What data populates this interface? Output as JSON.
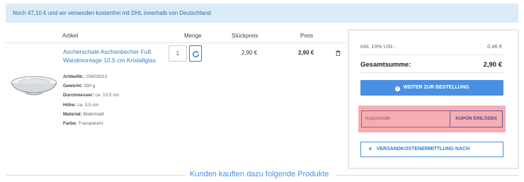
{
  "banner": {
    "text": "Noch 47,10 € und wir versenden kostenfrei mit DHL innerhalb von Deutschland"
  },
  "table": {
    "headers": {
      "article": "Artikel",
      "qty": "Menge",
      "unit_price": "Stückpreis",
      "price": "Preis"
    }
  },
  "item": {
    "title": "Ascherschale Aschenbecher Fuß Wandmontage 10,5 cm Kristallglas",
    "meta": [
      {
        "label": "ArtikelNr.:",
        "value": "GW03013"
      },
      {
        "label": "Gewicht:",
        "value": "330 g"
      },
      {
        "label": "Durchmesser:",
        "value": "ca. 10,5 cm"
      },
      {
        "label": "Höhe:",
        "value": "ca. 3,5 cm"
      },
      {
        "label": "Material:",
        "value": "Bleikristall"
      },
      {
        "label": "Farbe:",
        "value": "Transparent"
      }
    ],
    "quantity": "1",
    "unit_price": "2,90 €",
    "price": "2,90 €"
  },
  "summary": {
    "vat_label": "inkl. 19% USt.:",
    "vat_value": "0,46 €",
    "total_label": "Gesamtsumme:",
    "total_value": "2,90 €",
    "order_button": "WEITER ZUR BESTELLUNG",
    "coupon_placeholder": "Kuponcode",
    "coupon_button": "KUPON EINLÖSEN",
    "shipping_button": "VERSANDKOSTENERMITTLUNG NACH"
  },
  "footer": {
    "section_title": "Kunden kauften dazu folgende Produkte"
  },
  "colors": {
    "accent": "#4a90e2",
    "banner_bg": "#d9ecf7",
    "coupon_highlight": "#f7aeb2"
  }
}
